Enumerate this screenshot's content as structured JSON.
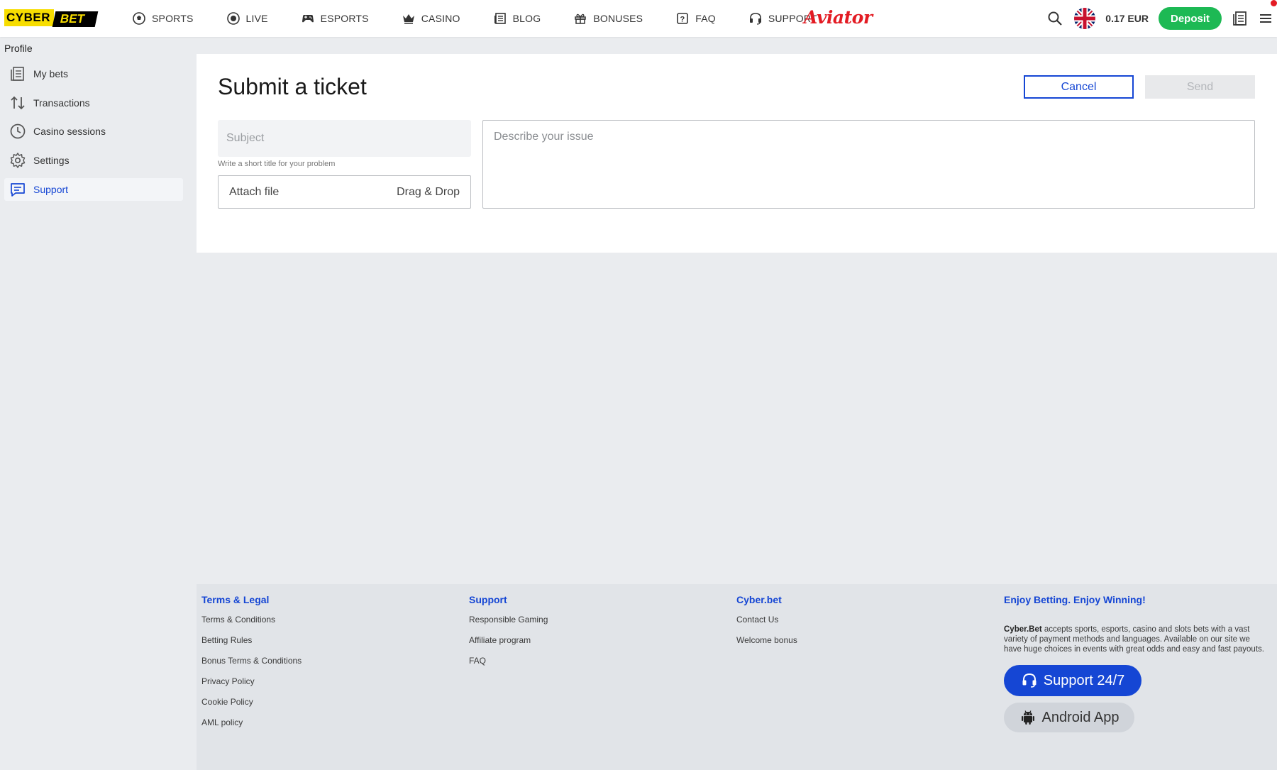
{
  "header": {
    "logo_left": "CYBER",
    "logo_right": "BET",
    "nav": [
      {
        "label": "SPORTS",
        "icon": "soccer-ball-icon"
      },
      {
        "label": "LIVE",
        "icon": "live-dot-icon"
      },
      {
        "label": "ESPORTS",
        "icon": "gamepad-icon"
      },
      {
        "label": "CASINO",
        "icon": "crown-icon"
      },
      {
        "label": "BLOG",
        "icon": "blog-icon"
      },
      {
        "label": "BONUSES",
        "icon": "gift-icon"
      },
      {
        "label": "FAQ",
        "icon": "question-icon"
      },
      {
        "label": "SUPPORT",
        "icon": "headset-icon"
      }
    ],
    "aviator": "Aviator",
    "balance": "0.17 EUR",
    "deposit": "Deposit"
  },
  "sidebar": {
    "title": "Profile",
    "items": [
      {
        "label": "My bets",
        "icon": "bets-icon"
      },
      {
        "label": "Transactions",
        "icon": "transactions-icon"
      },
      {
        "label": "Casino sessions",
        "icon": "clock-icon"
      },
      {
        "label": "Settings",
        "icon": "gear-icon"
      },
      {
        "label": "Support",
        "icon": "chat-icon",
        "active": true
      }
    ]
  },
  "form": {
    "title": "Submit a ticket",
    "cancel": "Cancel",
    "send": "Send",
    "subject_placeholder": "Subject",
    "subject_hint": "Write a short title for your problem",
    "attach_label": "Attach file",
    "drag_drop": "Drag & Drop",
    "describe_placeholder": "Describe your issue"
  },
  "footer": {
    "terms": {
      "title": "Terms & Legal",
      "links": [
        "Terms & Conditions",
        "Betting Rules",
        "Bonus Terms & Conditions",
        "Privacy Policy",
        "Cookie Policy",
        "AML policy"
      ]
    },
    "support": {
      "title": "Support",
      "links": [
        "Responsible Gaming",
        "Affiliate program",
        "FAQ"
      ]
    },
    "cyberbet": {
      "title": "Cyber.bet",
      "links": [
        "Contact Us",
        "Welcome bonus"
      ]
    },
    "enjoy": {
      "title": "Enjoy Betting. Enjoy Winning!",
      "brand": "Cyber.Bet",
      "text": " accepts sports, esports, casino and slots bets with a vast variety of payment methods and languages. Available on our site we have huge choices in events with great odds and easy and fast payouts.",
      "support_btn": "Support 24/7",
      "android_btn": "Android App"
    }
  },
  "colors": {
    "accent": "#1546d4",
    "deposit": "#1db954",
    "aviator": "#e31b23",
    "logo_yellow": "#f7dd00"
  }
}
